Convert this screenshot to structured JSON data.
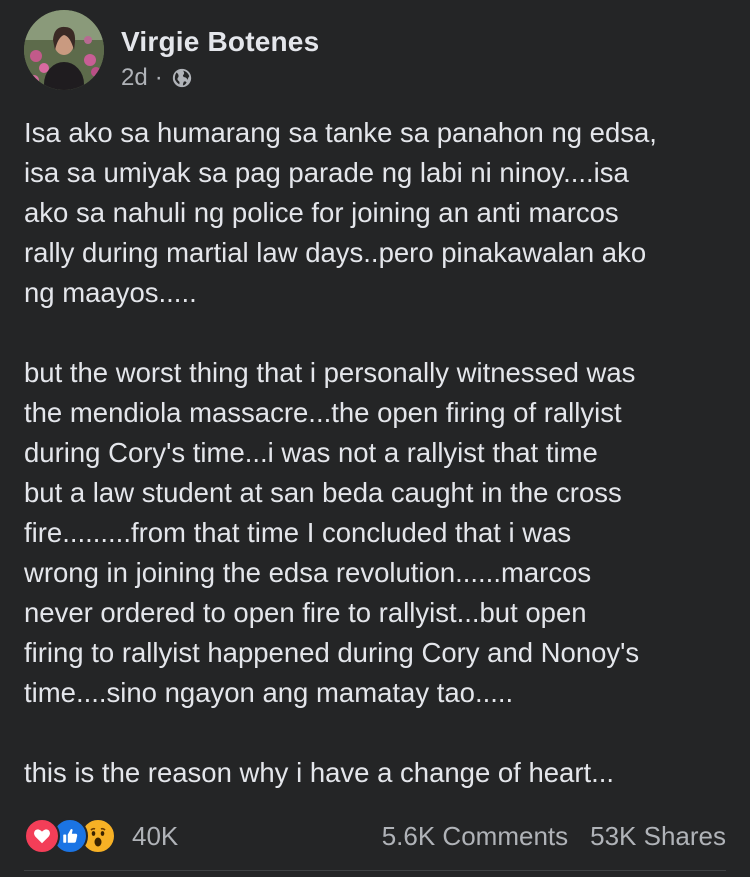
{
  "post": {
    "author": "Virgie Botenes",
    "time": "2d",
    "separator": "·",
    "privacy_icon": "globe-icon",
    "paragraphs": [
      [
        "Isa ako sa humarang sa tanke sa panahon ng edsa,",
        "isa sa umiyak sa pag parade ng labi ni ninoy....isa",
        "ako sa nahuli ng police for joining an anti marcos",
        "rally during martial law days..pero pinakawalan ako",
        "ng maayos....."
      ],
      [
        "but the worst thing that i personally witnessed was",
        "the mendiola massacre...the open firing of rallyist",
        "during Cory's time...i was not a rallyist that time",
        "but a law student at san beda caught in the cross",
        "fire.........from that time I concluded that i was",
        "wrong in joining the edsa revolution......marcos",
        "never ordered to open fire to rallyist...but open",
        "firing to rallyist happened during Cory and Nonoy's",
        "time....sino ngayon ang mamatay tao....."
      ],
      [
        "this is the reason why i have a change of heart..."
      ]
    ]
  },
  "footer": {
    "reactions": [
      "love-reaction-icon",
      "like-reaction-icon",
      "wow-reaction-icon"
    ],
    "reaction_count": "40K",
    "comments": "5.6K Comments",
    "shares": "53K Shares"
  },
  "colors": {
    "background": "#242526",
    "text_primary": "#e4e6eb",
    "text_secondary": "#b0b3b8",
    "love": "#f33e58",
    "like": "#1b74e4",
    "wow": "#f7b125"
  }
}
